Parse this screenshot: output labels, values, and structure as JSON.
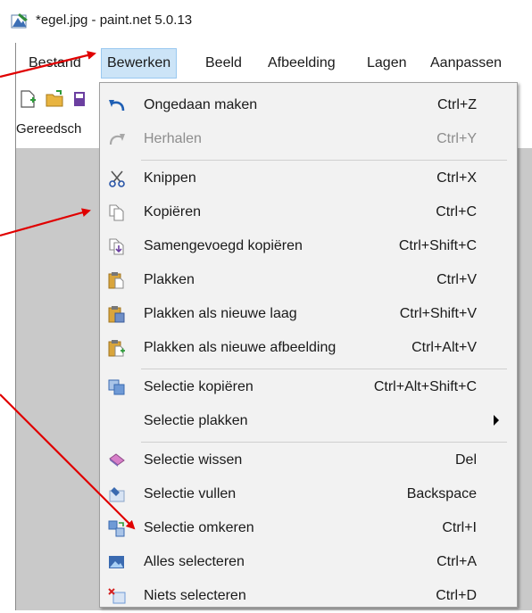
{
  "window": {
    "title": "*egel.jpg - paint.net 5.0.13"
  },
  "menubar": {
    "items": [
      "Bestand",
      "Bewerken",
      "Beeld",
      "Afbeelding",
      "Lagen",
      "Aanpassen"
    ]
  },
  "toolbar": {
    "label": "Gereedsch"
  },
  "menu": {
    "items": [
      {
        "label": "Ongedaan maken",
        "shortcut": "Ctrl+Z",
        "icon": "undo-icon"
      },
      {
        "label": "Herhalen",
        "shortcut": "Ctrl+Y",
        "icon": "redo-icon",
        "disabled": true
      },
      {
        "label": "Knippen",
        "shortcut": "Ctrl+X",
        "icon": "scissors-icon"
      },
      {
        "label": "Kopiëren",
        "shortcut": "Ctrl+C",
        "icon": "copy-icon"
      },
      {
        "label": "Samengevoegd kopiëren",
        "shortcut": "Ctrl+Shift+C",
        "icon": "copy-merged-icon"
      },
      {
        "label": "Plakken",
        "shortcut": "Ctrl+V",
        "icon": "paste-icon"
      },
      {
        "label": "Plakken als nieuwe laag",
        "shortcut": "Ctrl+Shift+V",
        "icon": "paste-layer-icon"
      },
      {
        "label": "Plakken als nieuwe afbeelding",
        "shortcut": "Ctrl+Alt+V",
        "icon": "paste-image-icon"
      },
      {
        "label": "Selectie kopiëren",
        "shortcut": "Ctrl+Alt+Shift+C",
        "icon": "copy-selection-icon"
      },
      {
        "label": "Selectie plakken",
        "shortcut": "",
        "icon": "",
        "submenu": true
      },
      {
        "label": "Selectie wissen",
        "shortcut": "Del",
        "icon": "eraser-icon"
      },
      {
        "label": "Selectie vullen",
        "shortcut": "Backspace",
        "icon": "fill-icon"
      },
      {
        "label": "Selectie omkeren",
        "shortcut": "Ctrl+I",
        "icon": "invert-selection-icon"
      },
      {
        "label": "Alles selecteren",
        "shortcut": "Ctrl+A",
        "icon": "select-all-icon"
      },
      {
        "label": "Niets selecteren",
        "shortcut": "Ctrl+D",
        "icon": "deselect-icon"
      }
    ]
  },
  "colors": {
    "accent": "#cce4f7",
    "arrow": "#e00000",
    "disabled_text": "#8d8d8d"
  }
}
